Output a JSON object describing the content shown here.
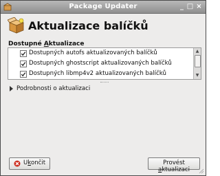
{
  "window": {
    "title": "Package Updater",
    "controls": {
      "minimize": "_",
      "maximize": "□",
      "close": "×"
    }
  },
  "header": {
    "title": "Aktualizace balíčků",
    "icon": "package-box-icon"
  },
  "section": {
    "label_mnemonic": "Dostupné ",
    "label_underlined": "A",
    "label_rest": "ktualizace"
  },
  "updates": [
    {
      "checked": true,
      "label": "Dostupných autofs aktualizovaných balíčků"
    },
    {
      "checked": true,
      "label": "Dostupných ghostscript aktualizovaných balíčků"
    },
    {
      "checked": true,
      "label": "Dostupných libmp4v2 aktualizovaných balíčků"
    }
  ],
  "details": {
    "label": "Podrobnosti o aktualizaci",
    "expanded": false
  },
  "buttons": {
    "quit_pre": "U",
    "quit_underlined": "k",
    "quit_post": "ončit",
    "apply_pre": "Provést ",
    "apply_underlined": "a",
    "apply_post": "ktualizaci"
  },
  "colors": {
    "titlebar": "#9f9f9f",
    "window_bg": "#edeceb",
    "list_bg": "#ffffff",
    "quit_icon": "#cc2b1c"
  }
}
